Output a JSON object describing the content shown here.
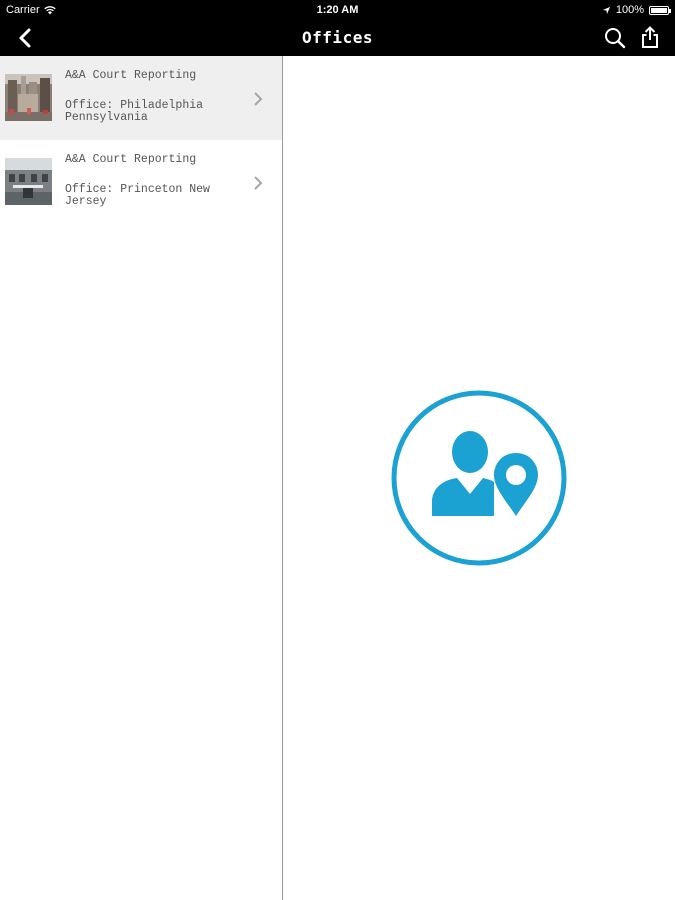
{
  "status_bar": {
    "carrier": "Carrier",
    "time": "1:20 AM",
    "battery": "100%"
  },
  "nav": {
    "title": "Offices"
  },
  "offices": [
    {
      "name": "A&A Court Reporting",
      "office": "Office: Philadelphia Pennsylvania",
      "selected": true
    },
    {
      "name": "A&A Court Reporting",
      "office": "Office: Princeton New Jersey",
      "selected": false
    }
  ],
  "colors": {
    "accent": "#1ba1d2",
    "bar": "#000000",
    "selected_row": "#efefef"
  },
  "icons": {
    "back": "chevron-left-icon",
    "search": "search-icon",
    "share": "share-icon",
    "placeholder": "contact-location-icon"
  }
}
